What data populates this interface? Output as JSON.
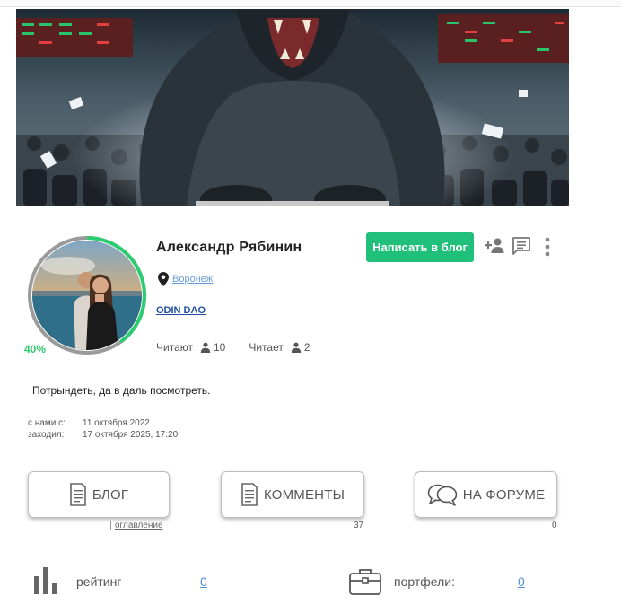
{
  "profile": {
    "name": "Александр Рябинин",
    "city": "Воронеж",
    "group": "ODIN DAO",
    "completion": "40%",
    "completion_fraction": 0.4,
    "followers_label": "Читают",
    "followers_count": "10",
    "following_label": "Читает",
    "following_count": "2",
    "status": "Потрындеть, да в даль посмотреть.",
    "since_label": "с нами с:",
    "since_value": "11 октября 2022",
    "visited_label": "заходил:",
    "visited_value": "17 октября 2025, 17:20"
  },
  "actions": {
    "write_blog": "Написать в блог",
    "accent_color": "#21c07a"
  },
  "sections": {
    "blog_label": "БЛОГ",
    "toc_label": "оглавление",
    "comments_label": "КОММЕНТЫ",
    "comments_count": "37",
    "forum_label": "НА ФОРУМЕ",
    "forum_count": "0"
  },
  "stats": {
    "rating_label": "рейтинг",
    "rating_value": "0",
    "portfolios_label": "портфели:",
    "portfolios_value": "0"
  },
  "icons": [
    "location-pin-icon",
    "person-icon",
    "add-friend-icon",
    "message-icon",
    "more-vert-icon",
    "blog-doc-icon",
    "comments-doc-icon",
    "forum-chat-icon",
    "rating-bars-icon",
    "briefcase-icon"
  ]
}
